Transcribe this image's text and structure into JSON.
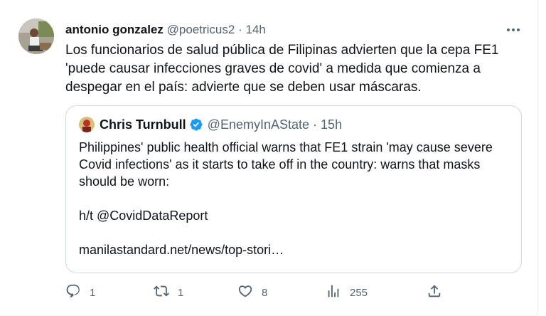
{
  "tweet": {
    "author_name": "antonio gonzalez",
    "handle": "@poetricus2",
    "separator": "·",
    "time": "14h",
    "text": "Los funcionarios de salud pública de Filipinas advierten que la cepa FE1 'puede causar infecciones graves de covid' a medida que comienza a despegar en el país: advierte que se deben usar máscaras."
  },
  "quote": {
    "author_name": "Chris Turnbull",
    "handle": "@EnemyInAState",
    "separator": "·",
    "time": "15h",
    "verified": true,
    "text_line1": "Philippines' public health official warns that FE1 strain 'may cause severe Covid infections' as it starts to take off in the country:  warns that masks should be worn:",
    "text_line2": "h/t @CovidDataReport",
    "text_line3": "manilastandard.net/news/top-stori…"
  },
  "actions": {
    "reply_count": "1",
    "retweet_count": "1",
    "like_count": "8",
    "views_count": "255"
  },
  "icons": {
    "more": "more-dots-icon",
    "reply": "reply-icon",
    "retweet": "retweet-icon",
    "like": "heart-icon",
    "views": "views-icon",
    "share": "share-icon",
    "verified": "verified-badge-icon"
  },
  "colors": {
    "text": "#0f1419",
    "muted": "#536471",
    "verified_blue": "#1d9bf0",
    "border": "#cfd9de"
  }
}
